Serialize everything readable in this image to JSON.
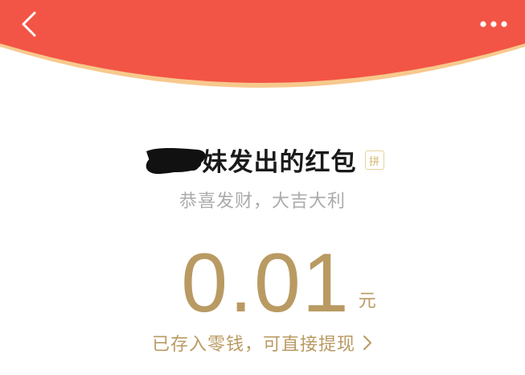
{
  "colors": {
    "header_red": "#f25545",
    "header_edge": "#f7c98d",
    "gold": "#b99a62",
    "title": "#1a1a1a",
    "subtitle": "#ababab"
  },
  "header": {
    "back_icon": "chevron-left-icon",
    "more_icon": "more-dots-icon"
  },
  "envelope": {
    "title": "妹发出的红包",
    "badge": "拼",
    "greeting": "恭喜发财，大吉大利",
    "amount": "0.01",
    "unit": "元",
    "wallet_link": "已存入零钱，可直接提现"
  }
}
